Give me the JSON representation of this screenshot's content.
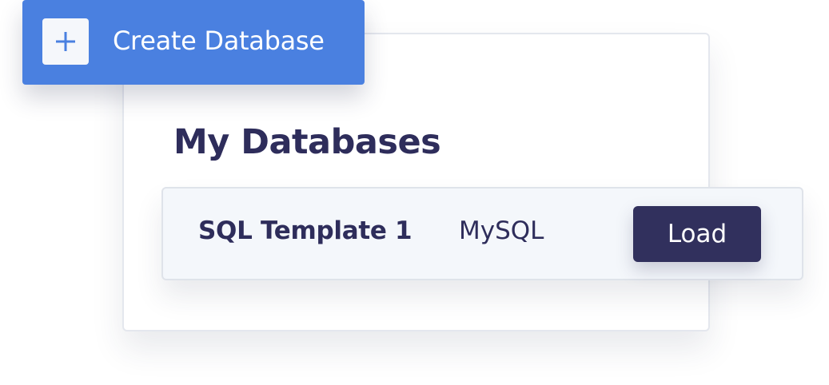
{
  "create_button": {
    "label": "Create Database",
    "icon": "plus-icon"
  },
  "panel": {
    "title": "My Databases"
  },
  "databases": [
    {
      "name": "SQL Template 1",
      "type": "MySQL",
      "action_label": "Load"
    }
  ],
  "colors": {
    "accent_blue": "#4a80e0",
    "navy": "#2e2d5b",
    "load_button": "#31305d",
    "row_background": "#f4f7fb"
  }
}
